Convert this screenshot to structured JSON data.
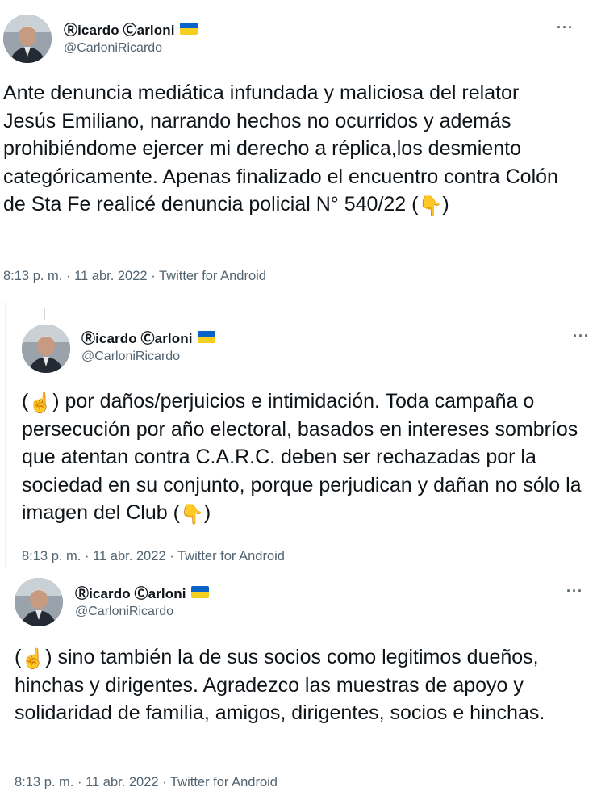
{
  "author": {
    "display_name": "Ⓡicardo Ⓒarloni",
    "handle": "@CarloniRicardo",
    "flag_icon": "ukraine-flag-icon",
    "flag_colors": [
      "#0a63c9",
      "#f5cf1f"
    ]
  },
  "tweets": [
    {
      "text_before": "Ante denuncia mediática infundada y maliciosa del relator Jesús Emiliano, narrando hechos no ocurridos y además prohibiéndome ejercer mi derecho a réplica,los desmiento categóricamente. Apenas finalizado el encuentro contra Colón de Sta Fe realicé denuncia policial N° 540/22 (",
      "emoji": "👇",
      "text_after": ")",
      "time": "8:13 p. m.",
      "date": "11 abr. 2022",
      "source": "Twitter for Android"
    },
    {
      "text_before": "(",
      "emoji_start": "☝️",
      "text_middle": ") por daños/perjuicios e intimidación. Toda campaña o persecución por año electoral, basados en intereses sombríos que atentan contra C.A.R.C. deben ser rechazadas por la sociedad en su conjunto, porque perjudican y dañan no sólo la imagen del Club (",
      "emoji_end": "👇",
      "text_after": ")",
      "time": "8:13 p. m.",
      "date": "11 abr. 2022",
      "source": "Twitter for Android"
    },
    {
      "text_before": "(",
      "emoji_start": "☝️",
      "text_after": ") sino también la de sus socios como legitimos dueños, hinchas y dirigentes. Agradezco las muestras de apoyo y solidaridad de familia, amigos, dirigentes, socios e hinchas.",
      "time": "8:13 p. m.",
      "date": "11 abr. 2022",
      "source": "Twitter for Android"
    }
  ],
  "more_label": "···",
  "separator": "·"
}
